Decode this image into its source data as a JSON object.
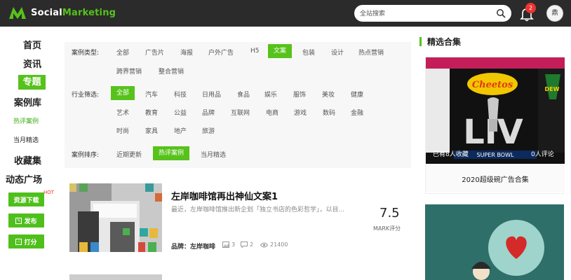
{
  "header": {
    "brand_prefix": "Social",
    "brand_suffix": "Marketing",
    "search_placeholder": "全站搜索",
    "notification_count": "2",
    "avatar_text": "鼎"
  },
  "sidebar": {
    "items": [
      "首页",
      "资讯",
      "专题",
      "案例库"
    ],
    "sub_hot": "热评案例",
    "sub_month": "当月精选",
    "favorites": "收藏集",
    "plaza": "动态广场",
    "hot_badge": "HOT",
    "buttons": [
      "资源下载",
      "发布",
      "打分"
    ]
  },
  "filters": {
    "type_label": "案例类型:",
    "types_row1": [
      "全部",
      "广告片",
      "海报",
      "户外广告",
      "H5",
      "文案",
      "包装",
      "设计",
      "热点营销"
    ],
    "types_row2": [
      "跨界营销",
      "整合营销"
    ],
    "active_type": "文案",
    "industry_label": "行业筛选:",
    "industries_row1": [
      "全部",
      "汽车",
      "科技",
      "日用品",
      "食品",
      "娱乐",
      "服饰",
      "美妆",
      "健康"
    ],
    "industries_row2": [
      "艺术",
      "教育",
      "公益",
      "品牌",
      "互联网",
      "电商",
      "游戏",
      "数码",
      "金融"
    ],
    "industries_row3": [
      "时尚",
      "家具",
      "地产",
      "旅游"
    ],
    "active_industry": "全部",
    "sort_label": "案例排序:",
    "sorts": [
      "近期更新",
      "热评案例",
      "当月精选"
    ],
    "active_sort": "热评案例"
  },
  "article": {
    "title": "左岸咖啡馆再出神仙文案1",
    "desc": "最近，左岸咖啡馆推出新企划「独立书店的色彩哲学」，以目...",
    "score": "7.5",
    "score_label": "MARK评分",
    "brand": "品牌：左岸咖啡",
    "images": "3",
    "comments": "2",
    "views": "21400"
  },
  "right": {
    "heading": "精选合集",
    "card1_views": "已有8人收藏",
    "card1_comments": "0人评论",
    "card1_title": "2020超级碗广告合集",
    "card1_logo": "Cheetos",
    "card1_banner": "SUPER BOWL",
    "card1_big": "LIV"
  },
  "colors": {
    "accent": "#56c21b",
    "header_bg": "#2b2b2b",
    "badge": "#e33333"
  }
}
